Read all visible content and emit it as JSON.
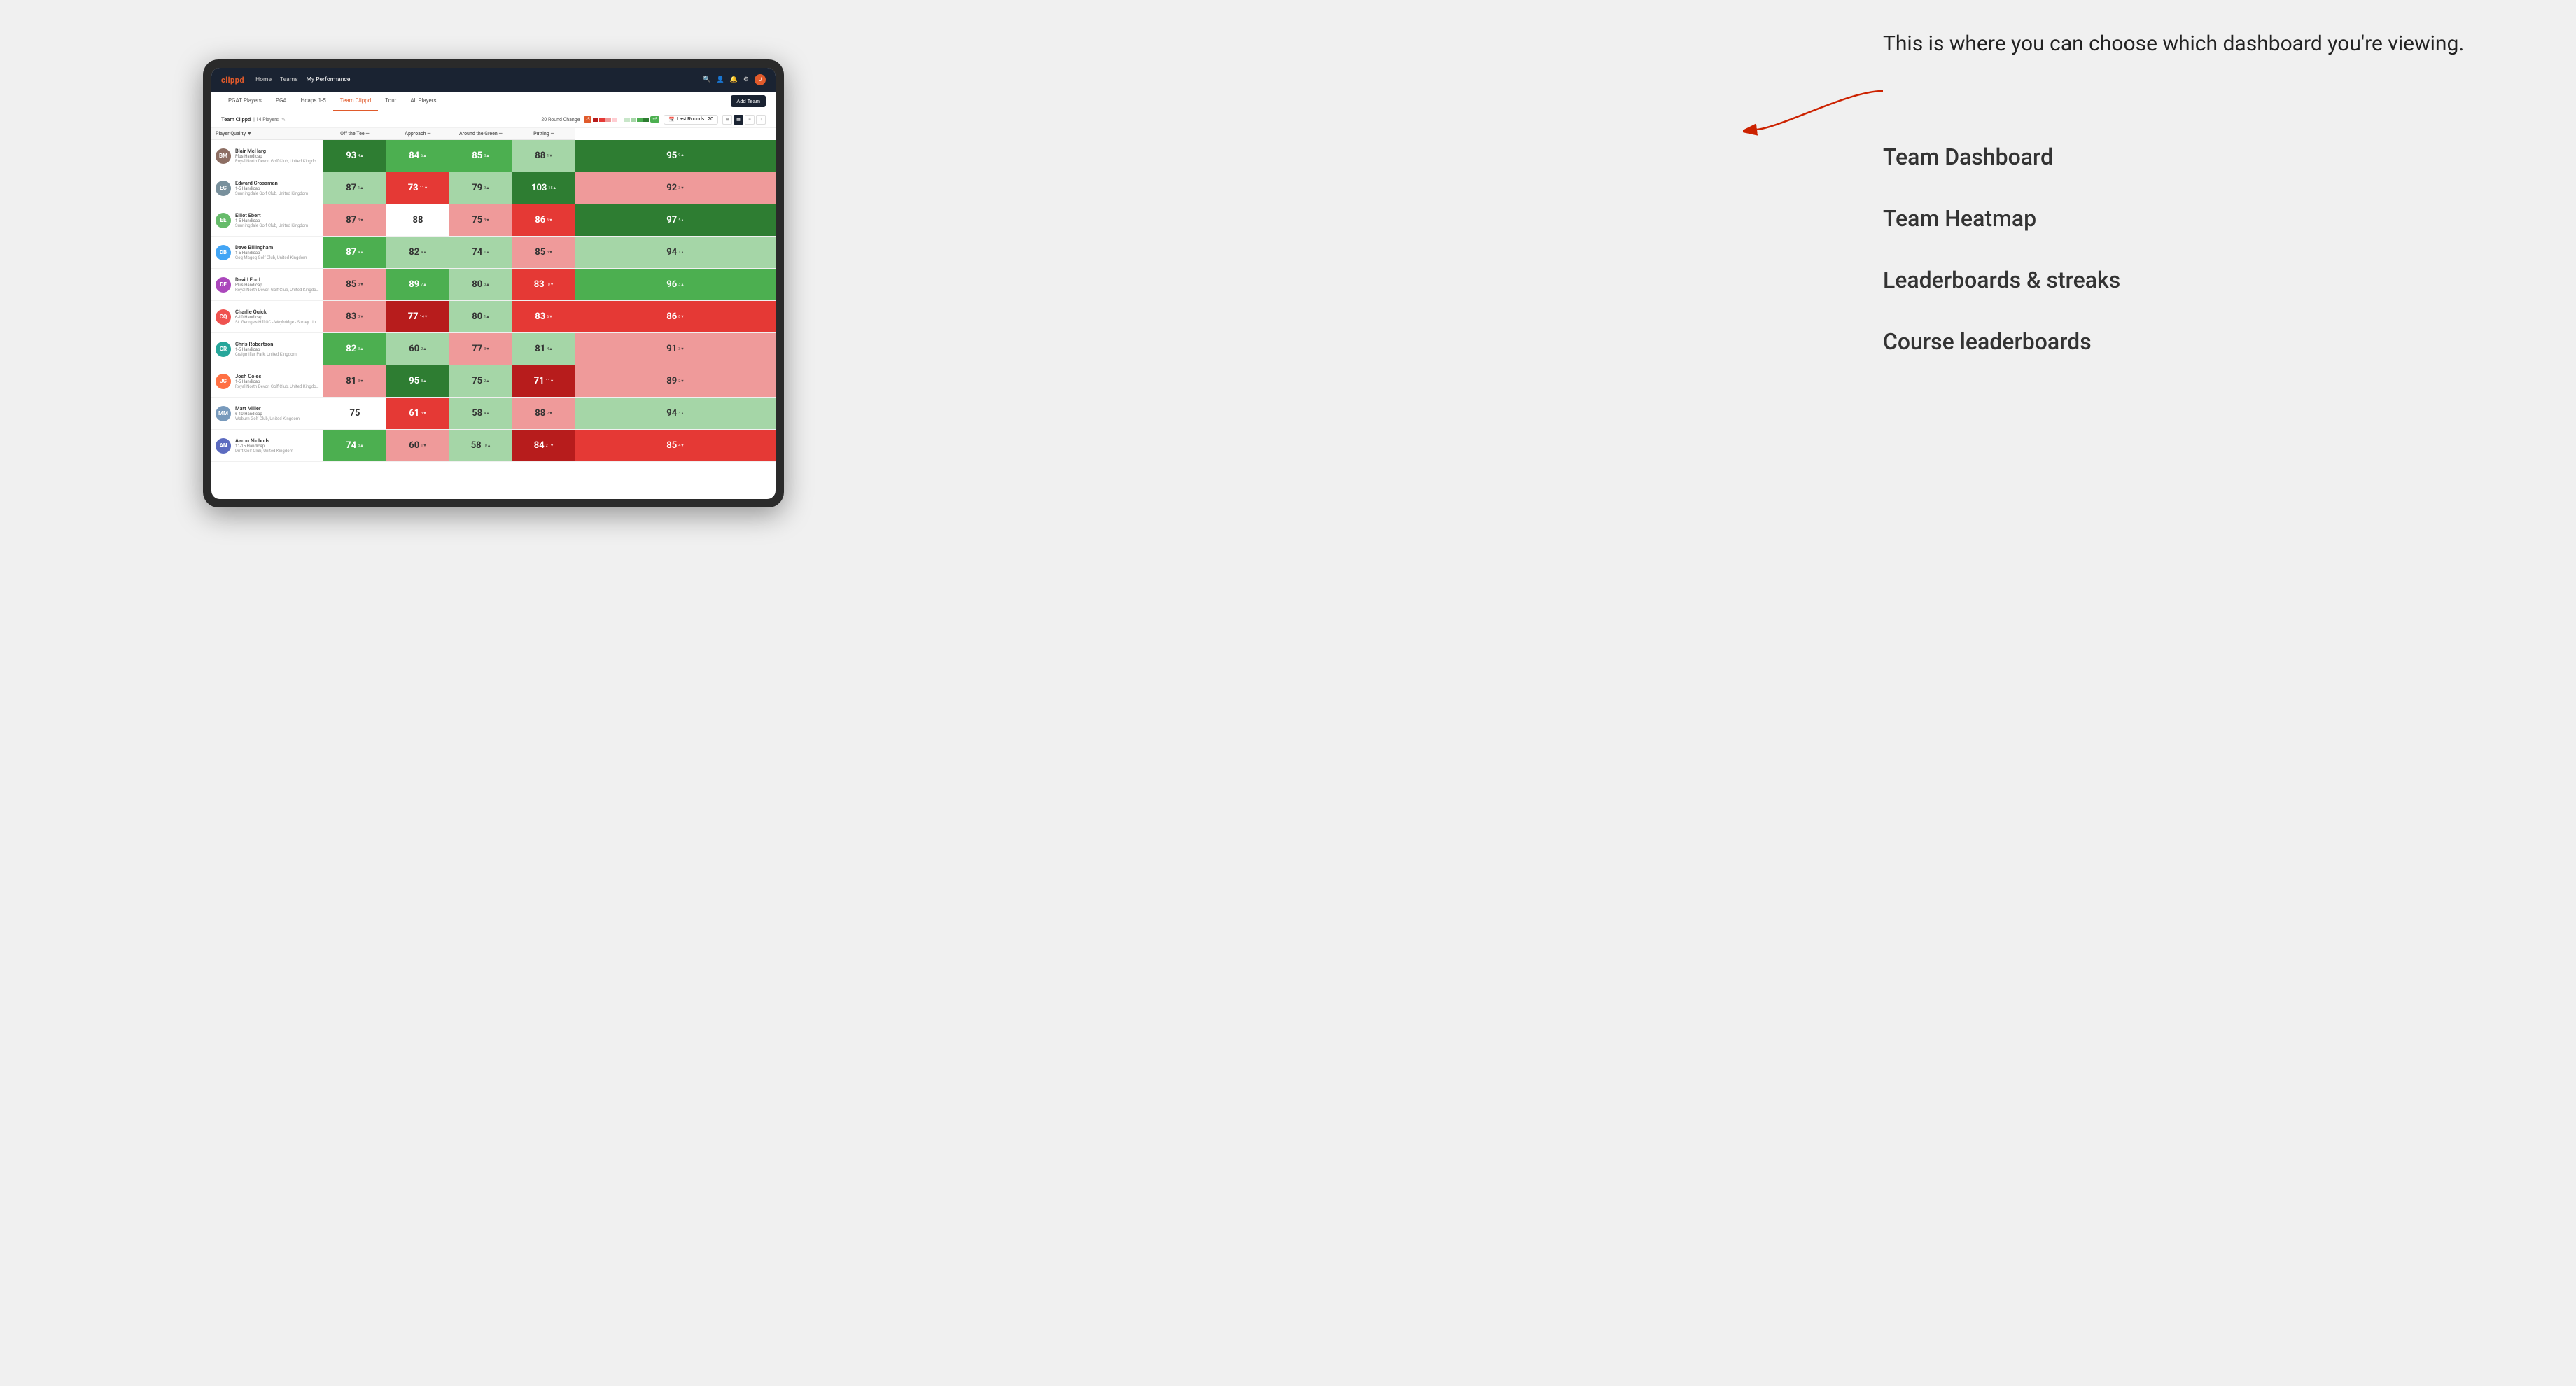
{
  "annotation": {
    "callout": "This is where you can choose which dashboard you're viewing.",
    "items": [
      "Team Dashboard",
      "Team Heatmap",
      "Leaderboards & streaks",
      "Course leaderboards"
    ]
  },
  "nav": {
    "logo": "clippd",
    "links": [
      "Home",
      "Teams",
      "My Performance"
    ],
    "active_link": "My Performance"
  },
  "tabs": {
    "items": [
      "PGAT Players",
      "PGA",
      "Hcaps 1-5",
      "Team Clippd",
      "Tour",
      "All Players"
    ],
    "active": "Team Clippd",
    "add_button": "Add Team"
  },
  "subheader": {
    "team_name": "Team Clippd",
    "separator": "|",
    "player_count": "14 Players",
    "round_change_label": "20 Round Change",
    "neg_val": "-5",
    "pos_val": "+5",
    "last_rounds_label": "Last Rounds:",
    "last_rounds_val": "20"
  },
  "table": {
    "columns": {
      "player": "Player Quality ▼",
      "off_tee": "Off the Tee —",
      "approach": "Approach —",
      "around_green": "Around the Green —",
      "putting": "Putting —"
    },
    "rows": [
      {
        "name": "Blair McHarg",
        "handicap": "Plus Handicap",
        "club": "Royal North Devon Golf Club, United Kingdom",
        "quality": {
          "val": 93,
          "change": "+4",
          "dir": "up",
          "color": "green-dark"
        },
        "off_tee": {
          "val": 84,
          "change": "+6",
          "dir": "up",
          "color": "green-med"
        },
        "approach": {
          "val": 85,
          "change": "+8",
          "dir": "up",
          "color": "green-med"
        },
        "around_green": {
          "val": 88,
          "change": "-1",
          "dir": "down",
          "color": "green-light"
        },
        "putting": {
          "val": 95,
          "change": "+9",
          "dir": "up",
          "color": "green-dark"
        }
      },
      {
        "name": "Edward Crossman",
        "handicap": "1-5 Handicap",
        "club": "Sunningdale Golf Club, United Kingdom",
        "quality": {
          "val": 87,
          "change": "+1",
          "dir": "up",
          "color": "green-light"
        },
        "off_tee": {
          "val": 73,
          "change": "-11",
          "dir": "down",
          "color": "red-med"
        },
        "approach": {
          "val": 79,
          "change": "+9",
          "dir": "up",
          "color": "green-light"
        },
        "around_green": {
          "val": 103,
          "change": "+15",
          "dir": "up",
          "color": "green-dark"
        },
        "putting": {
          "val": 92,
          "change": "-3",
          "dir": "down",
          "color": "red-light"
        }
      },
      {
        "name": "Elliot Ebert",
        "handicap": "1-5 Handicap",
        "club": "Sunningdale Golf Club, United Kingdom",
        "quality": {
          "val": 87,
          "change": "-3",
          "dir": "down",
          "color": "red-light"
        },
        "off_tee": {
          "val": 88,
          "change": "",
          "dir": "",
          "color": "neutral"
        },
        "approach": {
          "val": 75,
          "change": "-3",
          "dir": "down",
          "color": "red-light"
        },
        "around_green": {
          "val": 86,
          "change": "-6",
          "dir": "down",
          "color": "red-med"
        },
        "putting": {
          "val": 97,
          "change": "+5",
          "dir": "up",
          "color": "green-dark"
        }
      },
      {
        "name": "Dave Billingham",
        "handicap": "1-5 Handicap",
        "club": "Gog Magog Golf Club, United Kingdom",
        "quality": {
          "val": 87,
          "change": "+4",
          "dir": "up",
          "color": "green-med"
        },
        "off_tee": {
          "val": 82,
          "change": "+4",
          "dir": "up",
          "color": "green-light"
        },
        "approach": {
          "val": 74,
          "change": "+1",
          "dir": "up",
          "color": "green-light"
        },
        "around_green": {
          "val": 85,
          "change": "-3",
          "dir": "down",
          "color": "red-light"
        },
        "putting": {
          "val": 94,
          "change": "+1",
          "dir": "up",
          "color": "green-light"
        }
      },
      {
        "name": "David Ford",
        "handicap": "Plus Handicap",
        "club": "Royal North Devon Golf Club, United Kingdom",
        "quality": {
          "val": 85,
          "change": "-3",
          "dir": "down",
          "color": "red-light"
        },
        "off_tee": {
          "val": 89,
          "change": "+7",
          "dir": "up",
          "color": "green-med"
        },
        "approach": {
          "val": 80,
          "change": "+3",
          "dir": "up",
          "color": "green-light"
        },
        "around_green": {
          "val": 83,
          "change": "-10",
          "dir": "down",
          "color": "red-med"
        },
        "putting": {
          "val": 96,
          "change": "+3",
          "dir": "up",
          "color": "green-med"
        }
      },
      {
        "name": "Charlie Quick",
        "handicap": "6-10 Handicap",
        "club": "St. George's Hill GC - Weybridge - Surrey, Uni...",
        "quality": {
          "val": 83,
          "change": "-3",
          "dir": "down",
          "color": "red-light"
        },
        "off_tee": {
          "val": 77,
          "change": "-14",
          "dir": "down",
          "color": "red-dark"
        },
        "approach": {
          "val": 80,
          "change": "+1",
          "dir": "up",
          "color": "green-light"
        },
        "around_green": {
          "val": 83,
          "change": "-6",
          "dir": "down",
          "color": "red-med"
        },
        "putting": {
          "val": 86,
          "change": "-8",
          "dir": "down",
          "color": "red-med"
        }
      },
      {
        "name": "Chris Robertson",
        "handicap": "1-5 Handicap",
        "club": "Craigmillar Park, United Kingdom",
        "quality": {
          "val": 82,
          "change": "+3",
          "dir": "up",
          "color": "green-med"
        },
        "off_tee": {
          "val": 60,
          "change": "+2",
          "dir": "up",
          "color": "green-light"
        },
        "approach": {
          "val": 77,
          "change": "-3",
          "dir": "down",
          "color": "red-light"
        },
        "around_green": {
          "val": 81,
          "change": "+4",
          "dir": "up",
          "color": "green-light"
        },
        "putting": {
          "val": 91,
          "change": "-3",
          "dir": "down",
          "color": "red-light"
        }
      },
      {
        "name": "Josh Coles",
        "handicap": "1-5 Handicap",
        "club": "Royal North Devon Golf Club, United Kingdom",
        "quality": {
          "val": 81,
          "change": "-3",
          "dir": "down",
          "color": "red-light"
        },
        "off_tee": {
          "val": 95,
          "change": "+8",
          "dir": "up",
          "color": "green-dark"
        },
        "approach": {
          "val": 75,
          "change": "+2",
          "dir": "up",
          "color": "green-light"
        },
        "around_green": {
          "val": 71,
          "change": "-11",
          "dir": "down",
          "color": "red-dark"
        },
        "putting": {
          "val": 89,
          "change": "-2",
          "dir": "down",
          "color": "red-light"
        }
      },
      {
        "name": "Matt Miller",
        "handicap": "6-10 Handicap",
        "club": "Woburn Golf Club, United Kingdom",
        "quality": {
          "val": 75,
          "change": "",
          "dir": "",
          "color": "neutral"
        },
        "off_tee": {
          "val": 61,
          "change": "-3",
          "dir": "down",
          "color": "red-med"
        },
        "approach": {
          "val": 58,
          "change": "+4",
          "dir": "up",
          "color": "green-light"
        },
        "around_green": {
          "val": 88,
          "change": "-2",
          "dir": "down",
          "color": "red-light"
        },
        "putting": {
          "val": 94,
          "change": "+3",
          "dir": "up",
          "color": "green-light"
        }
      },
      {
        "name": "Aaron Nicholls",
        "handicap": "11-15 Handicap",
        "club": "Drift Golf Club, United Kingdom",
        "quality": {
          "val": 74,
          "change": "+8",
          "dir": "up",
          "color": "green-med"
        },
        "off_tee": {
          "val": 60,
          "change": "-1",
          "dir": "down",
          "color": "red-light"
        },
        "approach": {
          "val": 58,
          "change": "+10",
          "dir": "up",
          "color": "green-light"
        },
        "around_green": {
          "val": 84,
          "change": "-21",
          "dir": "down",
          "color": "red-dark"
        },
        "putting": {
          "val": 85,
          "change": "-4",
          "dir": "down",
          "color": "red-med"
        }
      }
    ]
  },
  "colors": {
    "green_dark": "#2e7d32",
    "green_med": "#4caf50",
    "green_light": "#a5d6a7",
    "neutral": "#ffffff",
    "red_light": "#ef9a9a",
    "red_med": "#e53935",
    "red_dark": "#b71c1c",
    "nav_bg": "#1a2332",
    "brand_orange": "#e05a2b"
  }
}
